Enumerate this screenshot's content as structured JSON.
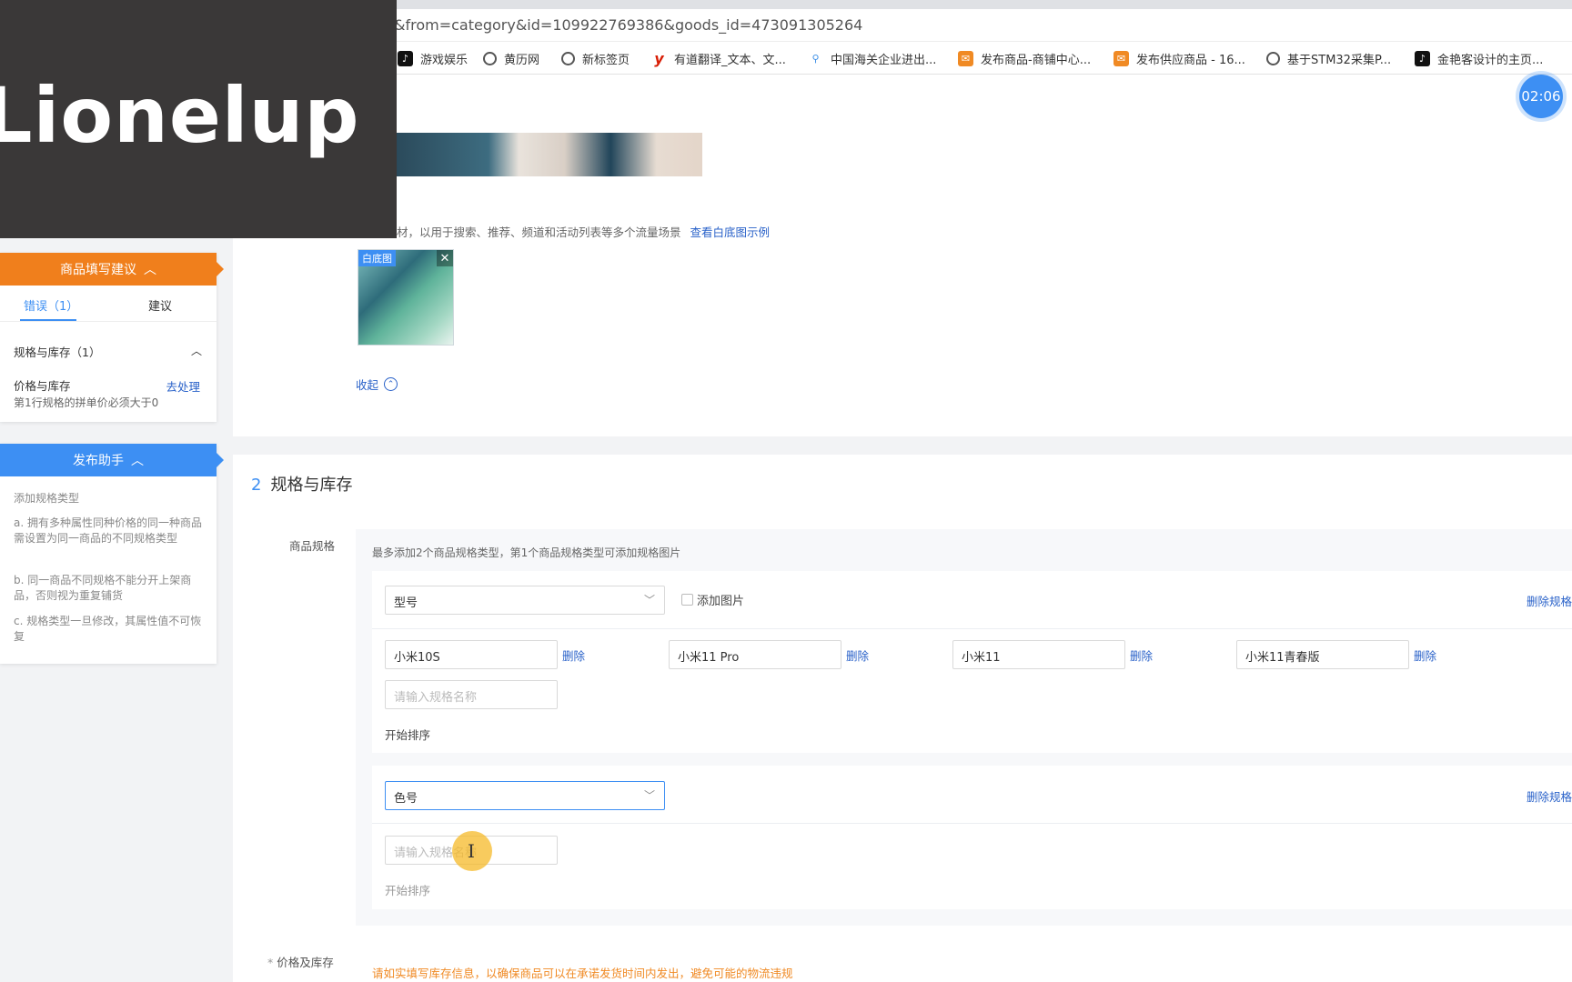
{
  "browser": {
    "url": "&from=category&id=109922769386&goods_id=473091305264",
    "bookmarks": [
      {
        "icon": "tiktok-icon",
        "label": "游戏娱乐"
      },
      {
        "icon": "globe-icon",
        "label": "黄历网"
      },
      {
        "icon": "globe-icon",
        "label": "新标签页"
      },
      {
        "icon": "youdao-icon",
        "label": "有道翻译_文本、文..."
      },
      {
        "icon": "pin-icon",
        "label": "中国海关企业进出..."
      },
      {
        "icon": "shop-icon",
        "label": "发布商品-商铺中心..."
      },
      {
        "icon": "shop-icon",
        "label": "发布供应商品 - 16..."
      },
      {
        "icon": "globe-icon",
        "label": "基于STM32采集P..."
      },
      {
        "icon": "tiktok-icon",
        "label": "金艳客设计的主页..."
      }
    ]
  },
  "timer": "02:06",
  "overlay": {
    "brand_text": "Lionelup"
  },
  "image_section": {
    "hint": "材，以用于搜索、推荐、频道和活动列表等多个流量场景",
    "hint_link": "查看白底图示例",
    "thumb_tag": "白底图",
    "thumb_close": "✕",
    "collapse": "收起"
  },
  "spec_section": {
    "number": "2",
    "title": "规格与库存",
    "spec_label": "商品规格",
    "spec_desc": "最多添加2个商品规格类型，第1个商品规格类型可添加规格图片",
    "group1": {
      "type": "型号",
      "add_pic": "添加图片",
      "delete_spec": "删除规格",
      "values": [
        "小米10S",
        "小米11 Pro",
        "小米11",
        "小米11青春版"
      ],
      "delete_label": "删除",
      "placeholder": "请输入规格名称",
      "sort": "开始排序"
    },
    "group2": {
      "type": "色号",
      "delete_spec": "删除规格",
      "placeholder": "请输入规格名称",
      "sort": "开始排序"
    },
    "price_label": "价格及库存",
    "price_required": "*",
    "price_warning": "请如实填写库存信息，以确保商品可以在承诺发货时间内发出，避免可能的物流违规"
  },
  "suggest_panel": {
    "title": "商品填写建议",
    "tab_error": "错误（1）",
    "tab_suggest": "建议",
    "group": "规格与库存（1）",
    "item_title": "价格与库存",
    "item_link": "去处理",
    "item_desc": "第1行规格的拼单价必须大于0"
  },
  "helper_panel": {
    "title": "发布助手",
    "heading": "添加规格类型",
    "tip_a": "a. 拥有多种属性同种价格的同一种商品需设置为同一商品的不同规格类型",
    "tip_b": "b. 同一商品不同规格不能分开上架商品，否则视为重复铺货",
    "tip_c": "c. 规格类型一旦修改，其属性值不可恢复"
  },
  "colors": {
    "accent_blue": "#3d8ff3",
    "accent_orange": "#f07f1c",
    "link_blue": "#2a62c9"
  }
}
